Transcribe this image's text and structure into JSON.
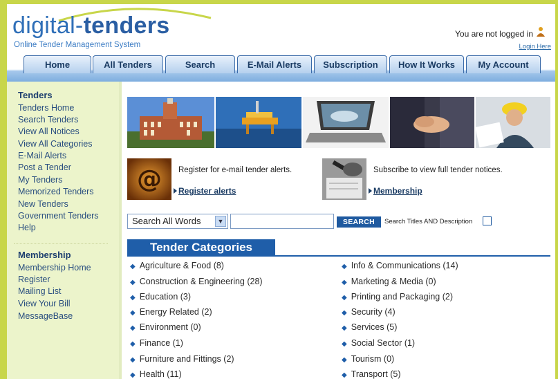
{
  "brand": {
    "name_part1": "digital-",
    "name_part2": "tenders",
    "subtitle": "Online Tender Management System"
  },
  "header": {
    "login_status": "You are not logged in",
    "login_link": "Login Here"
  },
  "nav": {
    "tabs": [
      "Home",
      "All Tenders",
      "Search",
      "E-Mail Alerts",
      "Subscription",
      "How It Works",
      "My Account"
    ]
  },
  "sidebar": {
    "tenders_heading": "Tenders",
    "tenders_links": [
      "Tenders Home",
      "Search Tenders",
      "View All Notices",
      "View All Categories",
      "E-Mail Alerts",
      "Post a Tender",
      "My Tenders",
      "Memorized Tenders",
      "New Tenders",
      "Government Tenders",
      "Help"
    ],
    "membership_heading": "Membership",
    "membership_links": [
      "Membership Home",
      "Register",
      "Mailing List",
      "View Your Bill",
      "MessageBase"
    ]
  },
  "promo": {
    "alerts_text": "Register for e-mail tender alerts.",
    "alerts_link": "Register alerts",
    "subscribe_text": "Subscribe to view full tender notices.",
    "subscribe_link": "Membership"
  },
  "search": {
    "mode_selected": "Search All Words",
    "input_value": "",
    "button_label": "SEARCH",
    "description_option": "Search Titles AND Description",
    "description_checked": false
  },
  "categories": {
    "heading": "Tender Categories",
    "left": [
      "Agriculture & Food (8)",
      "Construction & Engineering (28)",
      "Education (3)",
      "Energy Related (2)",
      "Environment (0)",
      "Finance (1)",
      "Furniture and Fittings (2)",
      "Health (11)"
    ],
    "right": [
      "Info & Communications (14)",
      "Marketing & Media (0)",
      "Printing and Packaging (2)",
      "Security (4)",
      "Services (5)",
      "Social Sector (1)",
      "Tourism (0)",
      "Transport (5)"
    ]
  },
  "colors": {
    "frame_green": "#c8d64a",
    "brand_blue": "#2f6fb8",
    "category_blue": "#1f5ea9",
    "sidebar_bg": "#ecf4cb"
  },
  "icons": [
    "user-icon",
    "email-at-icon",
    "pen-contract-icon",
    "arrow-right-icon",
    "dropdown-chevron-icon",
    "bullet-icon"
  ]
}
